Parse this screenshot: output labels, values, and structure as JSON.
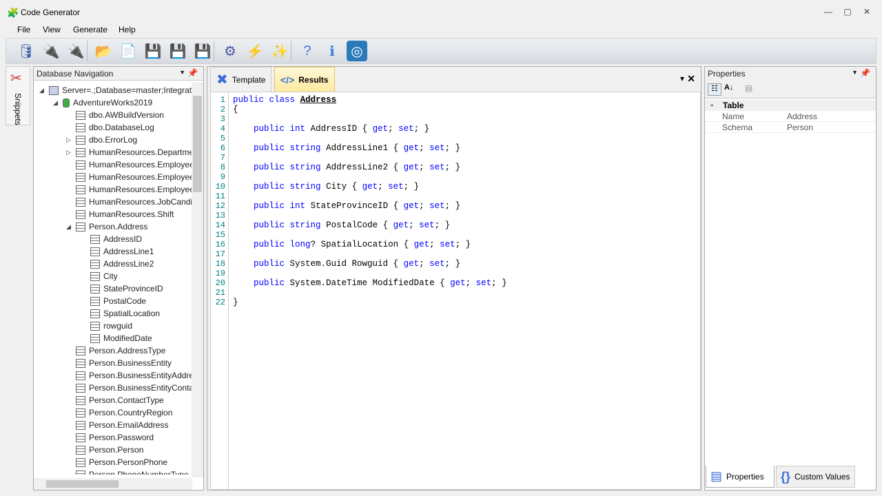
{
  "window": {
    "title": "Code Generator"
  },
  "menu": [
    "File",
    "View",
    "Generate",
    "Help"
  ],
  "toolbar": [
    {
      "icon": "database-icon",
      "g": "🛢",
      "c": "#3b5ea8"
    },
    {
      "icon": "connect-icon",
      "g": "🔌",
      "c": "#4a55a8"
    },
    {
      "icon": "disconnect-icon",
      "g": "🔌",
      "c": "#4a55a8"
    },
    {
      "icon": "open-folder-icon",
      "g": "📂",
      "c": "#e8a040"
    },
    {
      "icon": "new-file-icon",
      "g": "📄",
      "c": "#3b5ea8"
    },
    {
      "icon": "save-icon",
      "g": "💾",
      "c": "#3b5ea8"
    },
    {
      "icon": "save-as-icon",
      "g": "💾",
      "c": "#3b5ea8"
    },
    {
      "icon": "save-all-icon",
      "g": "💾",
      "c": "#3b5ea8"
    },
    {
      "icon": "settings-icon",
      "g": "⚙",
      "c": "#4a55a8"
    },
    {
      "icon": "generate-lightning-icon",
      "g": "⚡",
      "c": "#e8b020"
    },
    {
      "icon": "magic-wand-icon",
      "g": "✨",
      "c": "#d04040"
    },
    {
      "icon": "help-icon",
      "g": "?",
      "c": "#3b7dd8"
    },
    {
      "icon": "info-icon",
      "g": "ℹ",
      "c": "#3b7dd8"
    },
    {
      "icon": "brand-icon",
      "g": "◎",
      "c": "#2a7ab8"
    }
  ],
  "snippets": {
    "label": "Snippets"
  },
  "dbnav": {
    "title": "Database Navigation",
    "server": "Server=.;Database=master;Integrated",
    "database": "AdventureWorks2019",
    "tables": [
      "dbo.AWBuildVersion",
      "dbo.DatabaseLog",
      "dbo.ErrorLog",
      "HumanResources.Department",
      "HumanResources.Employee",
      "HumanResources.EmployeeDepartmentHistory",
      "HumanResources.EmployeePayHistory",
      "HumanResources.JobCandidate",
      "HumanResources.Shift",
      "Person.Address"
    ],
    "columns": [
      "AddressID",
      "AddressLine1",
      "AddressLine2",
      "City",
      "StateProvinceID",
      "PostalCode",
      "SpatialLocation",
      "rowguid",
      "ModifiedDate"
    ],
    "tables2": [
      "Person.AddressType",
      "Person.BusinessEntity",
      "Person.BusinessEntityAddress",
      "Person.BusinessEntityContact",
      "Person.ContactType",
      "Person.CountryRegion",
      "Person.EmailAddress",
      "Person.Password",
      "Person.Person",
      "Person.PersonPhone",
      "Person.PhoneNumberType"
    ]
  },
  "editor": {
    "tabs": [
      "Template",
      "Results"
    ],
    "active_tab": "Results",
    "lines": [
      [
        [
          "public",
          "kw"
        ],
        [
          " "
        ],
        [
          "class",
          "kw"
        ],
        [
          " "
        ],
        [
          "Address",
          "cn"
        ]
      ],
      [
        [
          "{"
        ]
      ],
      [],
      [
        [
          "    "
        ],
        [
          "public",
          "kw"
        ],
        [
          " "
        ],
        [
          "int",
          "kw"
        ],
        [
          " AddressID { "
        ],
        [
          "get",
          "kw"
        ],
        [
          "; "
        ],
        [
          "set",
          "kw"
        ],
        [
          "; }"
        ]
      ],
      [],
      [
        [
          "    "
        ],
        [
          "public",
          "kw"
        ],
        [
          " "
        ],
        [
          "string",
          "kw"
        ],
        [
          " AddressLine1 { "
        ],
        [
          "get",
          "kw"
        ],
        [
          "; "
        ],
        [
          "set",
          "kw"
        ],
        [
          "; }"
        ]
      ],
      [],
      [
        [
          "    "
        ],
        [
          "public",
          "kw"
        ],
        [
          " "
        ],
        [
          "string",
          "kw"
        ],
        [
          " AddressLine2 { "
        ],
        [
          "get",
          "kw"
        ],
        [
          "; "
        ],
        [
          "set",
          "kw"
        ],
        [
          "; }"
        ]
      ],
      [],
      [
        [
          "    "
        ],
        [
          "public",
          "kw"
        ],
        [
          " "
        ],
        [
          "string",
          "kw"
        ],
        [
          " City { "
        ],
        [
          "get",
          "kw"
        ],
        [
          "; "
        ],
        [
          "set",
          "kw"
        ],
        [
          "; }"
        ]
      ],
      [],
      [
        [
          "    "
        ],
        [
          "public",
          "kw"
        ],
        [
          " "
        ],
        [
          "int",
          "kw"
        ],
        [
          " StateProvinceID { "
        ],
        [
          "get",
          "kw"
        ],
        [
          "; "
        ],
        [
          "set",
          "kw"
        ],
        [
          "; }"
        ]
      ],
      [],
      [
        [
          "    "
        ],
        [
          "public",
          "kw"
        ],
        [
          " "
        ],
        [
          "string",
          "kw"
        ],
        [
          " PostalCode { "
        ],
        [
          "get",
          "kw"
        ],
        [
          "; "
        ],
        [
          "set",
          "kw"
        ],
        [
          "; }"
        ]
      ],
      [],
      [
        [
          "    "
        ],
        [
          "public",
          "kw"
        ],
        [
          " "
        ],
        [
          "long",
          "kw"
        ],
        [
          "? SpatialLocation { "
        ],
        [
          "get",
          "kw"
        ],
        [
          "; "
        ],
        [
          "set",
          "kw"
        ],
        [
          "; }"
        ]
      ],
      [],
      [
        [
          "    "
        ],
        [
          "public",
          "kw"
        ],
        [
          " System.Guid Rowguid { "
        ],
        [
          "get",
          "kw"
        ],
        [
          "; "
        ],
        [
          "set",
          "kw"
        ],
        [
          "; }"
        ]
      ],
      [],
      [
        [
          "    "
        ],
        [
          "public",
          "kw"
        ],
        [
          " System.DateTime ModifiedDate { "
        ],
        [
          "get",
          "kw"
        ],
        [
          "; "
        ],
        [
          "set",
          "kw"
        ],
        [
          "; }"
        ]
      ],
      [],
      [
        [
          "}"
        ]
      ]
    ]
  },
  "properties": {
    "title": "Properties",
    "category": "Table",
    "rows": [
      {
        "name": "Name",
        "value": "Address"
      },
      {
        "name": "Schema",
        "value": "Person"
      }
    ],
    "tabs": [
      "Properties",
      "Custom Values"
    ]
  }
}
